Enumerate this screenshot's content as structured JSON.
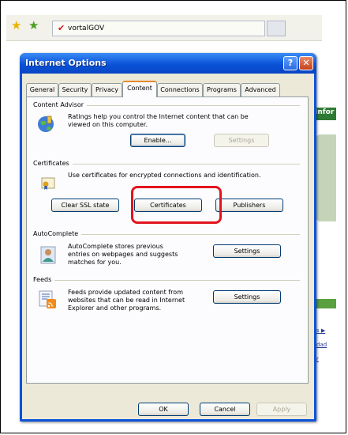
{
  "browser": {
    "tab_label": "vortalGOV",
    "side_text": "Infor",
    "links": [
      "tos ▶",
      "otdad",
      "rer"
    ]
  },
  "dialog": {
    "title": "Internet Options",
    "help_label": "?",
    "close_label": "✕",
    "tabs": [
      {
        "label": "General"
      },
      {
        "label": "Security"
      },
      {
        "label": "Privacy"
      },
      {
        "label": "Content"
      },
      {
        "label": "Connections"
      },
      {
        "label": "Programs"
      },
      {
        "label": "Advanced"
      }
    ],
    "active_tab": "Content",
    "content_advisor": {
      "title": "Content Advisor",
      "description": "Ratings help you control the Internet content that can be viewed on this computer.",
      "enable_label": "Enable...",
      "settings_label": "Settings"
    },
    "certificates": {
      "title": "Certificates",
      "description": "Use certificates for encrypted connections and identification.",
      "clear_ssl_label": "Clear SSL state",
      "certificates_label": "Certificates",
      "publishers_label": "Publishers"
    },
    "autocomplete": {
      "title": "AutoComplete",
      "description": "AutoComplete stores previous entries on webpages and suggests matches for you.",
      "settings_label": "Settings"
    },
    "feeds": {
      "title": "Feeds",
      "description": "Feeds provide updated content from websites that can be read in Internet Explorer and other programs.",
      "settings_label": "Settings"
    },
    "footer": {
      "ok_label": "OK",
      "cancel_label": "Cancel",
      "apply_label": "Apply"
    }
  },
  "colors": {
    "highlight": "#e3141e",
    "titlebar": "#0a52d8",
    "active_tab_accent": "#e68b2c"
  }
}
